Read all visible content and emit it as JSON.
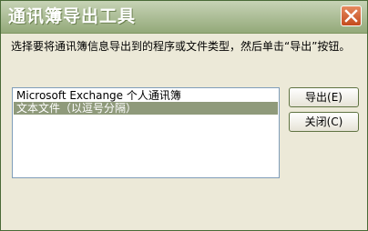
{
  "window": {
    "title": "通讯簿导出工具"
  },
  "message": "选择要将通讯簿信息导出到的程序或文件类型，然后单击“导出”按钮。",
  "list": {
    "items": [
      {
        "label": "Microsoft Exchange 个人通讯簿",
        "selected": false
      },
      {
        "label": "文本文件（以逗号分隔）",
        "selected": true
      }
    ]
  },
  "buttons": {
    "export_label": "导出(E)",
    "close_label": "关闭(C)"
  },
  "icons": {
    "close": "close-icon"
  },
  "colors": {
    "titlebar": "#93a979",
    "selection": "#8f9a7b",
    "close_button": "#c44a1d"
  }
}
